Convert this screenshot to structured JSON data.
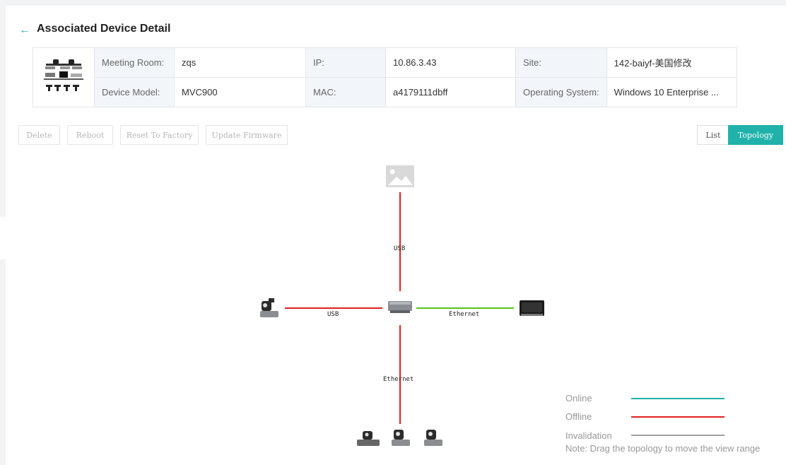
{
  "header": {
    "title": "Associated Device Detail",
    "back_icon": "arrow-left-icon"
  },
  "device": {
    "meeting_room_label": "Meeting Room:",
    "meeting_room": "zqs",
    "ip_label": "IP:",
    "ip": "10.86.3.43",
    "site_label": "Site:",
    "site": "142-baiyf-美国修改",
    "device_model_label": "Device Model:",
    "device_model": "MVC900",
    "mac_label": "MAC:",
    "mac": "a4179111dbff",
    "os_label": "Operating System:",
    "os": "Windows 10 Enterprise ..."
  },
  "actions": {
    "delete": "Delete",
    "reboot": "Reboot",
    "reset": "Reset To Factory",
    "update": "Update Firmware"
  },
  "view_toggle": {
    "list": "List",
    "topology": "Topology",
    "active": "Topology"
  },
  "topology": {
    "links": {
      "top": {
        "label": "USB",
        "status": "Offline"
      },
      "left": {
        "label": "USB",
        "status": "Offline"
      },
      "right": {
        "label": "Ethernet",
        "status": "Online"
      },
      "bottom": {
        "label": "Ethernet",
        "status": "Offline"
      }
    },
    "nodes": {
      "top": "image-placeholder-icon",
      "center": "hub-device-icon",
      "left": "ptz-camera-icon",
      "right": "touch-panel-icon",
      "bottom": [
        "camera-hub-icon",
        "ptz-camera-icon",
        "ptz-camera-icon"
      ]
    }
  },
  "legend": {
    "online": "Online",
    "offline": "Offline",
    "invalidation": "Invalidation",
    "colors": {
      "online": "#20b2aa",
      "offline": "#e02020",
      "invalidation": "#9e9e9e",
      "ethernet_ok": "#52c41a"
    }
  },
  "note": "Note: Drag the topology to move the view range"
}
